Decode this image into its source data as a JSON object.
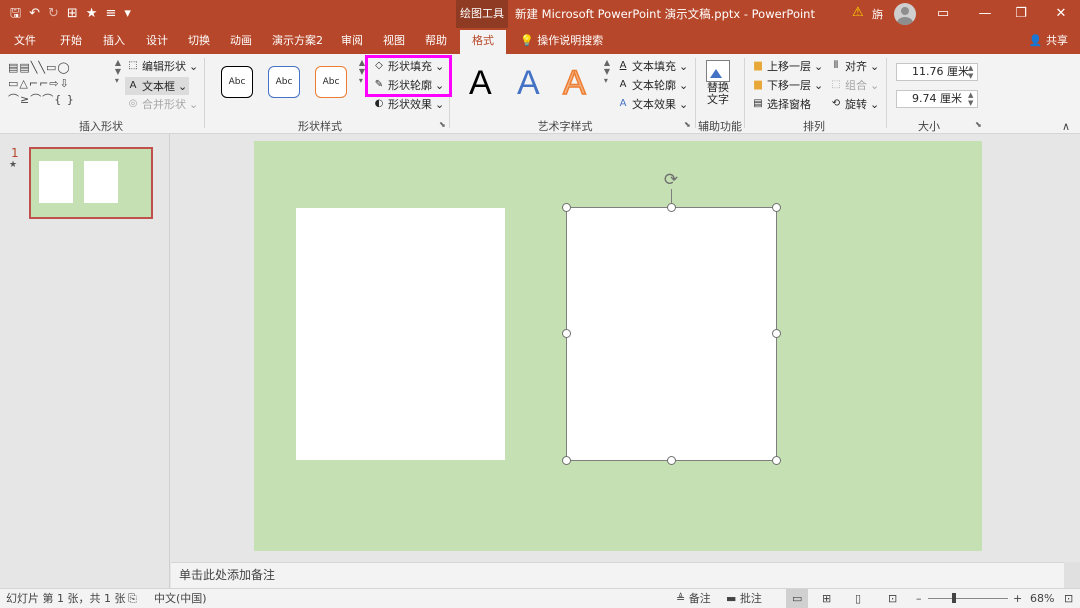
{
  "titlebar": {
    "context_group": "绘图工具",
    "title": "新建 Microsoft PowerPoint 演示文稿.pptx  -  PowerPoint",
    "user_name": "旃",
    "warning_icon": "warning-icon"
  },
  "tabs": [
    "文件",
    "开始",
    "插入",
    "设计",
    "切换",
    "动画",
    "演示方案2",
    "审阅",
    "视图",
    "帮助"
  ],
  "active_tab": "格式",
  "tell_me": "操作说明搜索",
  "share": "共享",
  "ribbon": {
    "insert_shapes": {
      "label": "插入形状",
      "edit_shape": "编辑形状",
      "text_box": "文本框",
      "merge_shapes": "合并形状"
    },
    "shape_styles": {
      "label": "形状样式",
      "style_samples": [
        "Abc",
        "Abc",
        "Abc"
      ],
      "fill": "形状填充",
      "outline": "形状轮廓",
      "effects": "形状效果"
    },
    "wordart": {
      "label": "艺术字样式",
      "samples": [
        "A",
        "A",
        "A"
      ],
      "text_fill": "文本填充",
      "text_outline": "文本轮廓",
      "text_effects": "文本效果"
    },
    "accessibility": {
      "label": "辅助功能",
      "alt_text": [
        "替换",
        "文字"
      ]
    },
    "arrange": {
      "label": "排列",
      "bring_forward": "上移一层",
      "send_backward": "下移一层",
      "selection_pane": "选择窗格",
      "align": "对齐",
      "group": "组合",
      "rotate": "旋转"
    },
    "size": {
      "label": "大小",
      "height": "11.76 厘米",
      "width": "9.74 厘米"
    }
  },
  "slide_panel": {
    "slide_number": "1",
    "transition_mark": "★"
  },
  "notes_placeholder": "单击此处添加备注",
  "status": {
    "slide_info": "幻灯片 第 1 张，共 1 张",
    "language": "中文(中国)",
    "notes": "备注",
    "comments": "批注",
    "zoom_minus": "–",
    "zoom_plus": "+",
    "zoom": "68%"
  },
  "colors": {
    "accent": "#b7472a",
    "slide_background": "#c5e0b3",
    "highlight": "#ff00ff"
  }
}
